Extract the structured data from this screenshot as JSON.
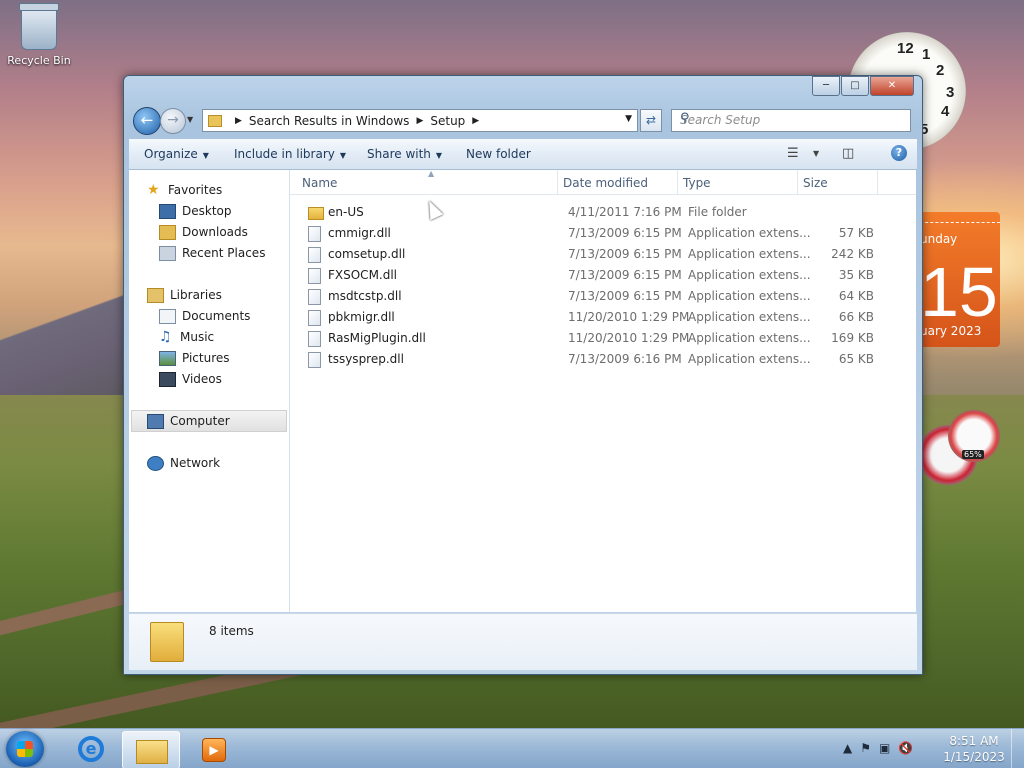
{
  "desktop": {
    "recycle_bin_label": "Recycle Bin",
    "calendar": {
      "day": "unday",
      "date": "15",
      "month": "uary 2023"
    },
    "meter_label": "65%"
  },
  "window": {
    "address": {
      "crumbs": [
        "Search Results in Windows",
        "Setup"
      ]
    },
    "search": {
      "placeholder": "Search Setup"
    },
    "commands": {
      "organize": "Organize",
      "include_in_library": "Include in library",
      "share_with": "Share with",
      "new_folder": "New folder"
    },
    "nav": {
      "favorites": "Favorites",
      "desktop": "Desktop",
      "downloads": "Downloads",
      "recent_places": "Recent Places",
      "libraries": "Libraries",
      "documents": "Documents",
      "music": "Music",
      "pictures": "Pictures",
      "videos": "Videos",
      "computer": "Computer",
      "network": "Network"
    },
    "columns": {
      "name": "Name",
      "date": "Date modified",
      "type": "Type",
      "size": "Size"
    },
    "files": [
      {
        "name": "en-US",
        "date": "4/11/2011 7:16 PM",
        "type": "File folder",
        "size": ""
      },
      {
        "name": "cmmigr.dll",
        "date": "7/13/2009 6:15 PM",
        "type": "Application extens...",
        "size": "57 KB"
      },
      {
        "name": "comsetup.dll",
        "date": "7/13/2009 6:15 PM",
        "type": "Application extens...",
        "size": "242 KB"
      },
      {
        "name": "FXSOCM.dll",
        "date": "7/13/2009 6:15 PM",
        "type": "Application extens...",
        "size": "35 KB"
      },
      {
        "name": "msdtcstp.dll",
        "date": "7/13/2009 6:15 PM",
        "type": "Application extens...",
        "size": "64 KB"
      },
      {
        "name": "pbkmigr.dll",
        "date": "11/20/2010 1:29 PM",
        "type": "Application extens...",
        "size": "66 KB"
      },
      {
        "name": "RasMigPlugin.dll",
        "date": "11/20/2010 1:29 PM",
        "type": "Application extens...",
        "size": "169 KB"
      },
      {
        "name": "tssysprep.dll",
        "date": "7/13/2009 6:16 PM",
        "type": "Application extens...",
        "size": "65 KB"
      }
    ],
    "details": {
      "count": "8 items"
    }
  },
  "taskbar": {
    "time": "8:51 AM",
    "date": "1/15/2023"
  }
}
